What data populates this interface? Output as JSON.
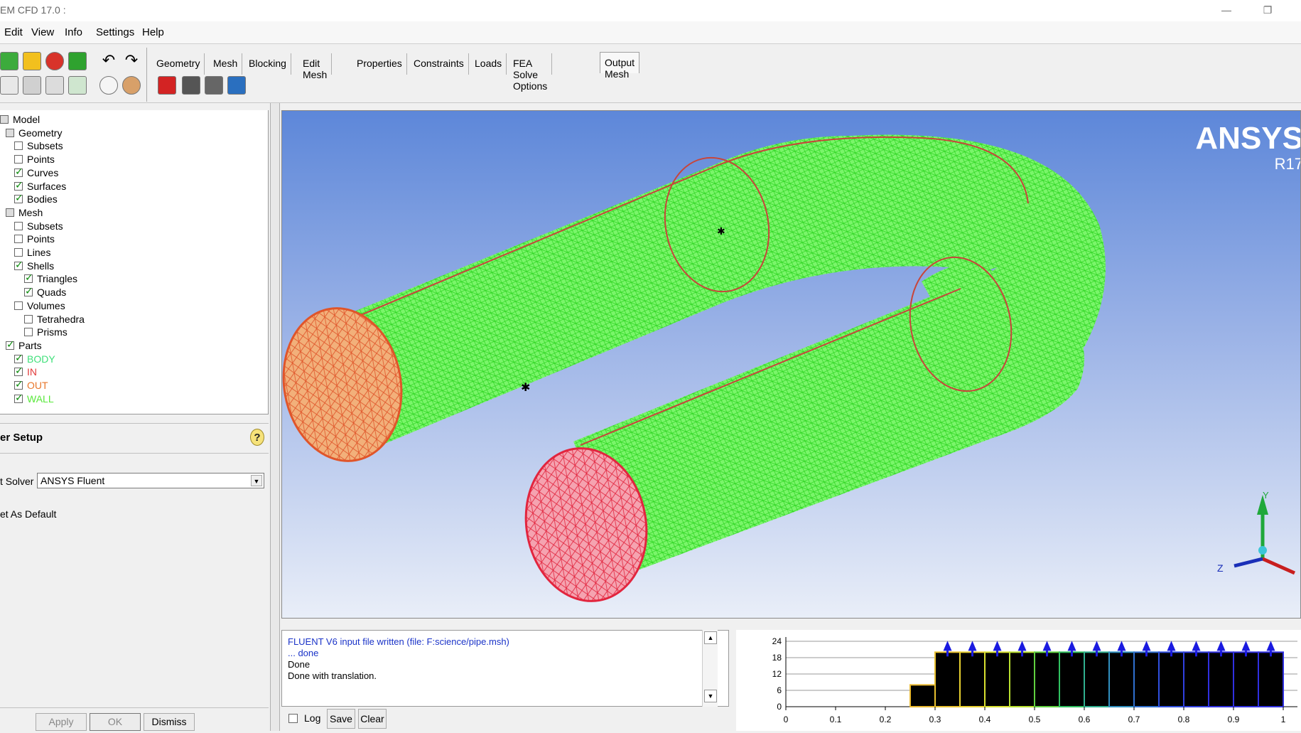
{
  "window": {
    "title": "EM CFD 17.0 :",
    "minimize": "—",
    "restore": "❐"
  },
  "menu": [
    "Edit",
    "View",
    "Info",
    "Settings",
    "Help"
  ],
  "tabs": [
    "Geometry",
    "Mesh",
    "Blocking",
    "Edit Mesh",
    "Properties",
    "Constraints",
    "Loads",
    "FEA Solve Options",
    "Output Mesh"
  ],
  "active_tab": "Output Mesh",
  "tree": [
    {
      "label": "Model",
      "level": 0,
      "checked": "partial"
    },
    {
      "label": "Geometry",
      "level": 1,
      "checked": "partial"
    },
    {
      "label": "Subsets",
      "level": 2,
      "checked": "off"
    },
    {
      "label": "Points",
      "level": 2,
      "checked": "off"
    },
    {
      "label": "Curves",
      "level": 2,
      "checked": "on"
    },
    {
      "label": "Surfaces",
      "level": 2,
      "checked": "on"
    },
    {
      "label": "Bodies",
      "level": 2,
      "checked": "on"
    },
    {
      "label": "Mesh",
      "level": 1,
      "checked": "partial"
    },
    {
      "label": "Subsets",
      "level": 2,
      "checked": "off"
    },
    {
      "label": "Points",
      "level": 2,
      "checked": "off"
    },
    {
      "label": "Lines",
      "level": 2,
      "checked": "off"
    },
    {
      "label": "Shells",
      "level": 2,
      "checked": "on"
    },
    {
      "label": "Triangles",
      "level": 3,
      "checked": "on"
    },
    {
      "label": "Quads",
      "level": 3,
      "checked": "on"
    },
    {
      "label": "Volumes",
      "level": 2,
      "checked": "off"
    },
    {
      "label": "Tetrahedra",
      "level": 3,
      "checked": "off"
    },
    {
      "label": "Prisms",
      "level": 3,
      "checked": "off"
    },
    {
      "label": "Parts",
      "level": 1,
      "checked": "on"
    },
    {
      "label": "BODY",
      "level": 2,
      "checked": "on",
      "color": "#3fe07a"
    },
    {
      "label": "IN",
      "level": 2,
      "checked": "on",
      "color": "#e23a3a"
    },
    {
      "label": "OUT",
      "level": 2,
      "checked": "on",
      "color": "#e8762a"
    },
    {
      "label": "WALL",
      "level": 2,
      "checked": "on",
      "color": "#58e83a"
    }
  ],
  "setup": {
    "title": "er Setup",
    "help": "?",
    "solver_label": "t Solver",
    "solver_value": "ANSYS Fluent",
    "default_label": "et As Default"
  },
  "buttons": {
    "apply": "Apply",
    "ok": "OK",
    "dismiss": "Dismiss"
  },
  "viewport": {
    "logo": "ANSYS",
    "version": "R17",
    "axis_y": "Y",
    "axis_z": "Z"
  },
  "messages": [
    {
      "text": "FLUENT V6 input file written (file: F:science/pipe.msh)",
      "color": "#1a33c8"
    },
    {
      "text": "... done",
      "color": "#1a33c8"
    },
    {
      "text": "Done",
      "color": "#000000"
    },
    {
      "text": "Done with translation.",
      "color": "#000000"
    }
  ],
  "msgtools": {
    "log": "Log",
    "save": "Save",
    "clear": "Clear"
  },
  "histogram": {
    "y_ticks": [
      "24",
      "18",
      "12",
      "6",
      "0"
    ],
    "x_ticks": [
      "0",
      "0.1",
      "0.2",
      "0.3",
      "0.4",
      "0.5",
      "0.6",
      "0.7",
      "0.8",
      "0.9",
      "1"
    ],
    "bins": [
      {
        "x0": 0.25,
        "x1": 0.3,
        "value": 8
      },
      {
        "x0": 0.3,
        "x1": 0.35,
        "value": 20
      },
      {
        "x0": 0.35,
        "x1": 0.4,
        "value": 20
      },
      {
        "x0": 0.4,
        "x1": 0.45,
        "value": 20
      },
      {
        "x0": 0.45,
        "x1": 0.5,
        "value": 20
      },
      {
        "x0": 0.5,
        "x1": 0.55,
        "value": 20
      },
      {
        "x0": 0.55,
        "x1": 0.6,
        "value": 20
      },
      {
        "x0": 0.6,
        "x1": 0.65,
        "value": 20
      },
      {
        "x0": 0.65,
        "x1": 0.7,
        "value": 20
      },
      {
        "x0": 0.7,
        "x1": 0.75,
        "value": 20
      },
      {
        "x0": 0.75,
        "x1": 0.8,
        "value": 20
      },
      {
        "x0": 0.8,
        "x1": 0.85,
        "value": 20
      },
      {
        "x0": 0.85,
        "x1": 0.9,
        "value": 20
      },
      {
        "x0": 0.9,
        "x1": 0.95,
        "value": 20
      },
      {
        "x0": 0.95,
        "x1": 1.0,
        "value": 20
      }
    ],
    "ymax": 24
  }
}
